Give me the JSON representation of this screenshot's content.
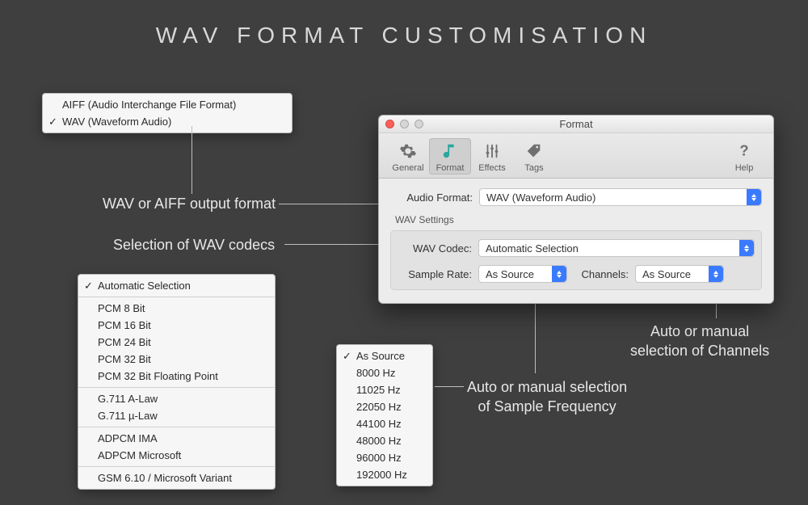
{
  "title": "WAV  FORMAT  CUSTOMISATION",
  "annotations": {
    "format": "WAV or AIFF output format",
    "codec": "Selection of WAV codecs",
    "rate_l1": "Auto or manual selection",
    "rate_l2": "of Sample Frequency",
    "ch_l1": "Auto or manual",
    "ch_l2": "selection of Channels"
  },
  "format_popup": {
    "items": [
      "AIFF (Audio Interchange File Format)",
      "WAV (Waveform Audio)"
    ],
    "checked_index": 1
  },
  "codec_popup": {
    "groups": [
      [
        "Automatic Selection"
      ],
      [
        "PCM 8 Bit",
        "PCM 16 Bit",
        "PCM 24 Bit",
        "PCM 32 Bit",
        "PCM 32 Bit Floating Point"
      ],
      [
        "G.711 A-Law",
        "G.711 µ-Law"
      ],
      [
        "ADPCM IMA",
        "ADPCM Microsoft"
      ],
      [
        "GSM 6.10 / Microsoft Variant"
      ]
    ],
    "checked": "Automatic Selection"
  },
  "rate_popup": {
    "items": [
      "As Source",
      "8000 Hz",
      "11025 Hz",
      "22050 Hz",
      "44100 Hz",
      "48000 Hz",
      "96000 Hz",
      "192000 Hz"
    ],
    "checked_index": 0
  },
  "window": {
    "title": "Format",
    "tabs": [
      "General",
      "Format",
      "Effects",
      "Tags"
    ],
    "help": "Help",
    "labels": {
      "audio_format": "Audio Format:",
      "wav_settings": "WAV Settings",
      "wav_codec": "WAV Codec:",
      "sample_rate": "Sample Rate:",
      "channels": "Channels:"
    },
    "values": {
      "audio_format": "WAV (Waveform Audio)",
      "wav_codec": "Automatic Selection",
      "sample_rate": "As Source",
      "channels": "As Source"
    }
  }
}
